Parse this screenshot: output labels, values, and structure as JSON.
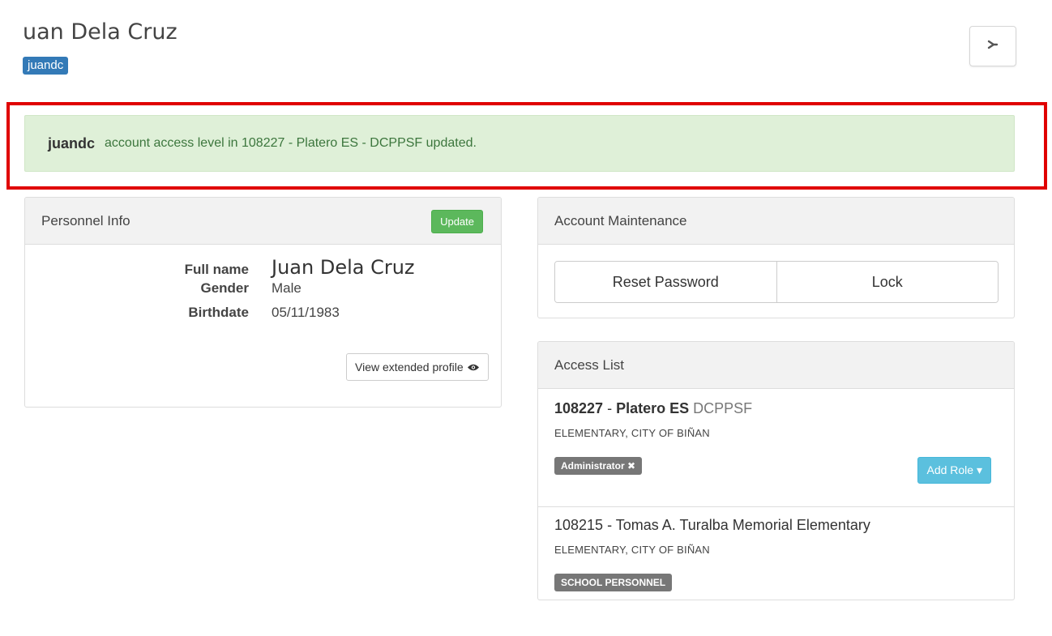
{
  "header": {
    "title": "uan Dela Cruz",
    "username_badge": "juandc",
    "close_icon": "collapse-icon"
  },
  "alert": {
    "user": "juandc",
    "message": "account access level in 108227 - Platero ES - DCPPSF updated.",
    "highlight_color": "#e00000"
  },
  "personnel_info": {
    "title": "Personnel Info",
    "update_label": "Update",
    "fields": [
      {
        "label": "Full name",
        "value": "Juan Dela Cruz"
      },
      {
        "label": "Gender",
        "value": "Male"
      },
      {
        "label": "Birthdate",
        "value": "05/11/1983"
      }
    ],
    "extended_profile_label": "View extended profile",
    "extended_profile_icon": "eye-icon"
  },
  "account_maintenance": {
    "title": "Account Maintenance",
    "reset_password_label": "Reset Password",
    "lock_label": "Lock"
  },
  "access_list": {
    "title": "Access List",
    "items": [
      {
        "code": "108227",
        "separator": " - ",
        "name": "Platero ES",
        "suffix": " DCPPSF",
        "subtitle": "ELEMENTARY, CITY OF BIÑAN",
        "role": "Administrator ✖",
        "add_role_label": "Add Role ▾"
      },
      {
        "title": "108215 - Tomas A. Turalba Memorial Elementary",
        "subtitle": "ELEMENTARY, CITY OF BIÑAN",
        "role": "SCHOOL PERSONNEL"
      }
    ]
  },
  "colors": {
    "success_bg": "#dff0d8",
    "success_text": "#3c763d",
    "primary": "#337ab7",
    "update_green": "#5cb85c",
    "info_blue": "#5bc0de",
    "role_gray": "#777777"
  }
}
